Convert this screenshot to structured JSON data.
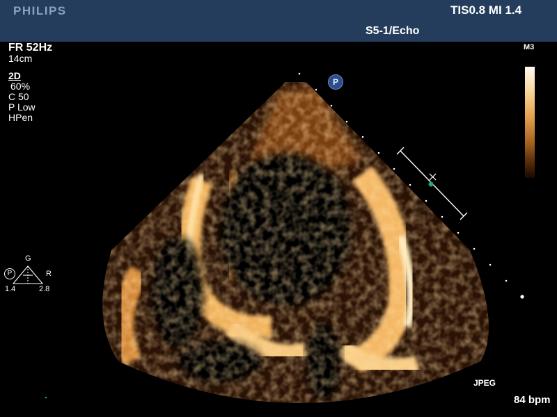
{
  "header": {
    "brand": "PHILIPS",
    "tis_mi": "TIS0.8   MI 1.4",
    "probe_preset": "S5-1/Echo"
  },
  "acquisition": {
    "frame_rate": "FR 52Hz",
    "depth": "14cm",
    "mode": "2D",
    "gain": "60%",
    "compression": "C 50",
    "power": "P Low",
    "harmonics": "HPen"
  },
  "grayscale_map": {
    "label": "M3"
  },
  "focus_indicator": {
    "g_label": "G",
    "p_label": "P",
    "r_label": "R",
    "left_value": "1.4",
    "right_value": "2.8"
  },
  "sector": {
    "orientation_marker": "P"
  },
  "footer": {
    "format": "JPEG",
    "heart_rate": "84 bpm"
  },
  "colors": {
    "header_bg": "#253d5c",
    "echo_bright": "#ffd58a",
    "echo_mid": "#d08a35",
    "echo_dark": "#6b3310"
  }
}
